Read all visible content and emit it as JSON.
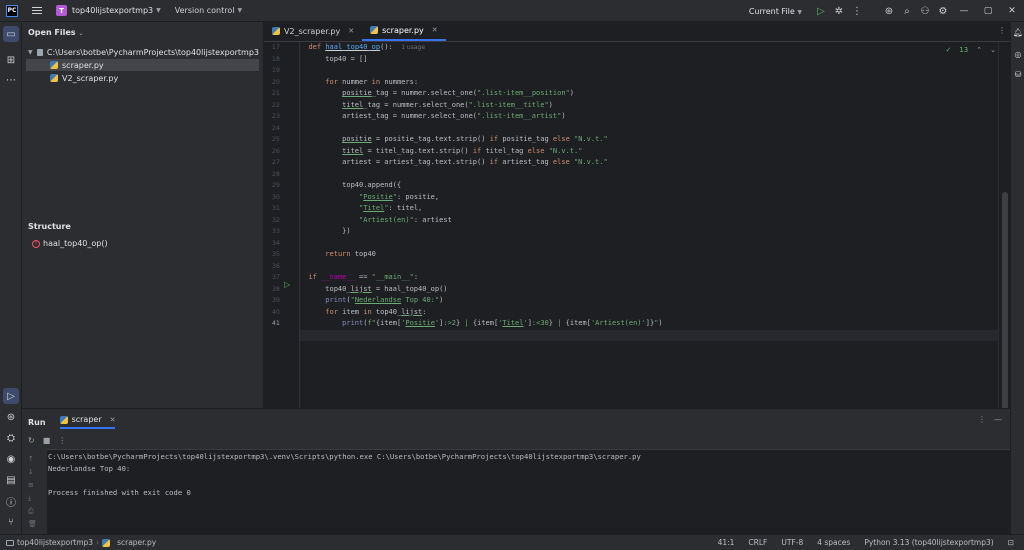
{
  "titlebar": {
    "project_badge": "T",
    "project_name": "top40lijstexportmp3",
    "version_control": "Version control",
    "run_config": "Current File",
    "icons": [
      "hamburger-icon",
      "run-icon",
      "debug-icon",
      "more-icon",
      "ai-assistant-icon",
      "search-icon",
      "add-user-icon",
      "settings-icon",
      "minimize-icon",
      "maximize-icon",
      "close-icon"
    ]
  },
  "project_panel": {
    "title": "Open Files",
    "root": "C:\\Users\\botbe\\PycharmProjects\\top40lijstexportmp3",
    "files": [
      {
        "name": "scraper.py",
        "selected": true
      },
      {
        "name": "V2_scraper.py",
        "selected": false
      }
    ],
    "structure_title": "Structure",
    "structure_item": "haal_top40_op()"
  },
  "editor": {
    "tabs": [
      {
        "label": "V2_scraper.py",
        "active": false
      },
      {
        "label": "scraper.py",
        "active": true
      }
    ],
    "usage_hint": "1 usage",
    "inspection_count": "13",
    "line_numbers": [
      "17",
      "18",
      "19",
      "20",
      "21",
      "22",
      "23",
      "24",
      "25",
      "26",
      "27",
      "28",
      "29",
      "30",
      "31",
      "32",
      "33",
      "34",
      "35",
      "36",
      "37",
      "38",
      "39",
      "40",
      "41"
    ],
    "current_line": "41"
  },
  "run_panel": {
    "title": "Run",
    "tab": "scraper",
    "output": [
      "C:\\Users\\botbe\\PycharmProjects\\top40lijstexportmp3\\.venv\\Scripts\\python.exe C:\\Users\\botbe\\PycharmProjects\\top40lijstexportmp3\\scraper.py",
      "Nederlandse Top 40:",
      "",
      "Process finished with exit code 0"
    ]
  },
  "statusbar": {
    "project": "top40lijstexportmp3",
    "file": "scraper.py",
    "position": "41:1",
    "line_ending": "CRLF",
    "encoding": "UTF-8",
    "indent": "4 spaces",
    "interpreter": "Python 3.13 (top40lijstexportmp3)"
  }
}
